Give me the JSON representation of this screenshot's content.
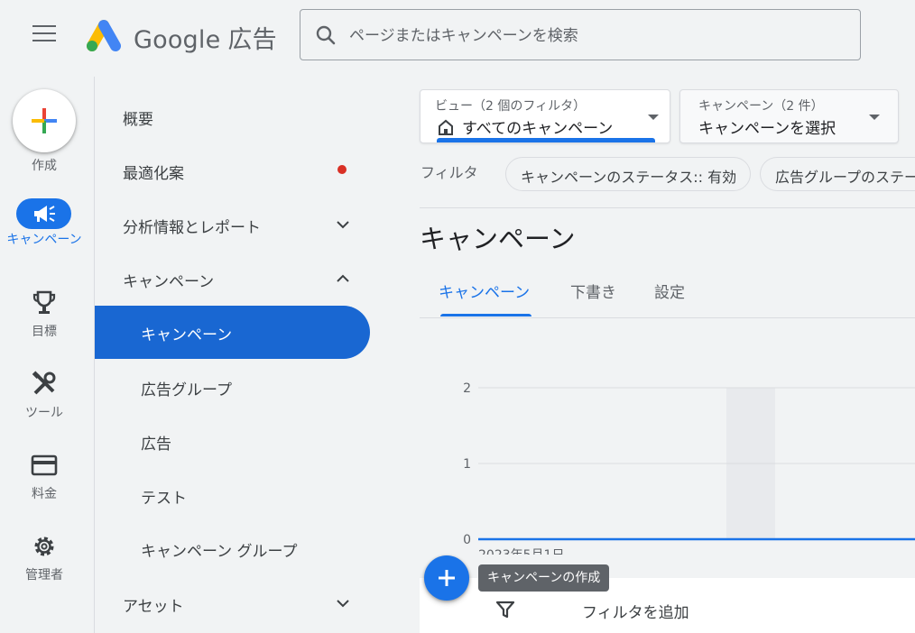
{
  "header": {
    "brand_google": "Google",
    "brand_ads": "広告",
    "search_placeholder": "ページまたはキャンペーンを検索"
  },
  "rail": {
    "create_label": "作成",
    "items": [
      {
        "label": "キャンペーン",
        "icon": "megaphone-icon",
        "active": true
      },
      {
        "label": "目標",
        "icon": "trophy-icon"
      },
      {
        "label": "ツール",
        "icon": "tools-icon"
      },
      {
        "label": "料金",
        "icon": "credit-card-icon"
      },
      {
        "label": "管理者",
        "icon": "gear-icon"
      }
    ]
  },
  "nav": {
    "overview": "概要",
    "recommendations": "最適化案",
    "insights": "分析情報とレポート",
    "campaigns_group": "キャンペーン",
    "campaigns": "キャンペーン",
    "ad_groups": "広告グループ",
    "ads": "広告",
    "tests": "テスト",
    "campaign_groups": "キャンペーン グループ",
    "assets": "アセット"
  },
  "view_dropdown": {
    "label": "ビュー（2 個のフィルタ）",
    "value": "すべてのキャンペーン"
  },
  "campaign_dropdown": {
    "label": "キャンペーン（2 件）",
    "value": "キャンペーンを選択"
  },
  "filters": {
    "label": "フィルタ",
    "chips": [
      "キャンペーンのステータス:: 有効",
      "広告グループのステータス"
    ]
  },
  "page": {
    "title": "キャンペーン",
    "tabs": [
      "キャンペーン",
      "下書き",
      "設定"
    ],
    "active_tab": 0
  },
  "chart_data": {
    "type": "line",
    "x": [
      "2023年5月1日"
    ],
    "x_tick_label": "2023年5月1日",
    "y_ticks": [
      "2",
      "1",
      "0"
    ],
    "ylim": [
      0,
      2
    ],
    "series": [
      {
        "values": [
          0
        ]
      }
    ],
    "grid": true
  },
  "bottom": {
    "tooltip": "キャンペーンの作成",
    "add_filter": "フィルタを追加"
  },
  "colors": {
    "accent": "#1a73e8",
    "active_nav": "#1967d2",
    "alert_dot": "#d93025"
  }
}
